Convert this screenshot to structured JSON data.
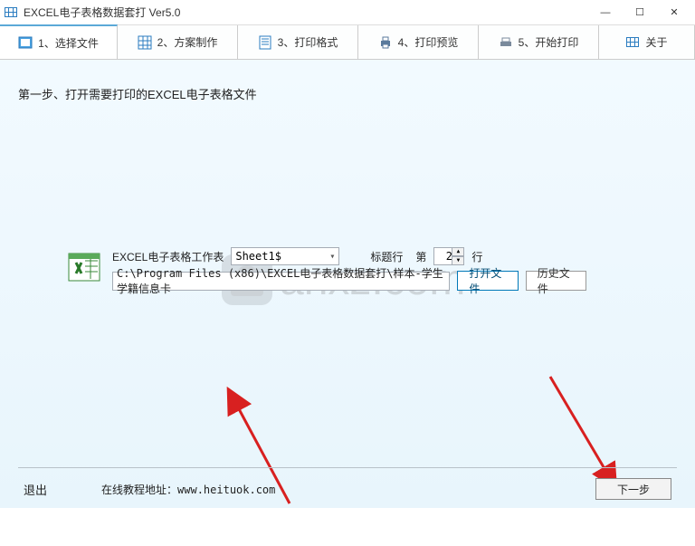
{
  "window": {
    "title": "EXCEL电子表格数据套打 Ver5.0"
  },
  "tabs": {
    "t1": "1、选择文件",
    "t2": "2、方案制作",
    "t3": "3、打印格式",
    "t4": "4、打印预览",
    "t5": "5、开始打印",
    "t6": "关于"
  },
  "step": {
    "title": "第一步、打开需要打印的EXCEL电子表格文件"
  },
  "form": {
    "worksheet_label": "EXCEL电子表格工作表",
    "sheet_value": "Sheet1$",
    "title_row_label": "标题行",
    "row_prefix": "第",
    "row_value": "2",
    "row_suffix": "行",
    "path_value": "C:\\Program Files (x86)\\EXCEL电子表格数据套打\\样本-学生学籍信息卡",
    "open_btn": "打开文件",
    "history_btn": "历史文件"
  },
  "footer": {
    "exit": "退出",
    "tutorial": "在线教程地址：www.heituok.com",
    "next": "下一步"
  },
  "watermark": {
    "text": "anxz.com"
  }
}
